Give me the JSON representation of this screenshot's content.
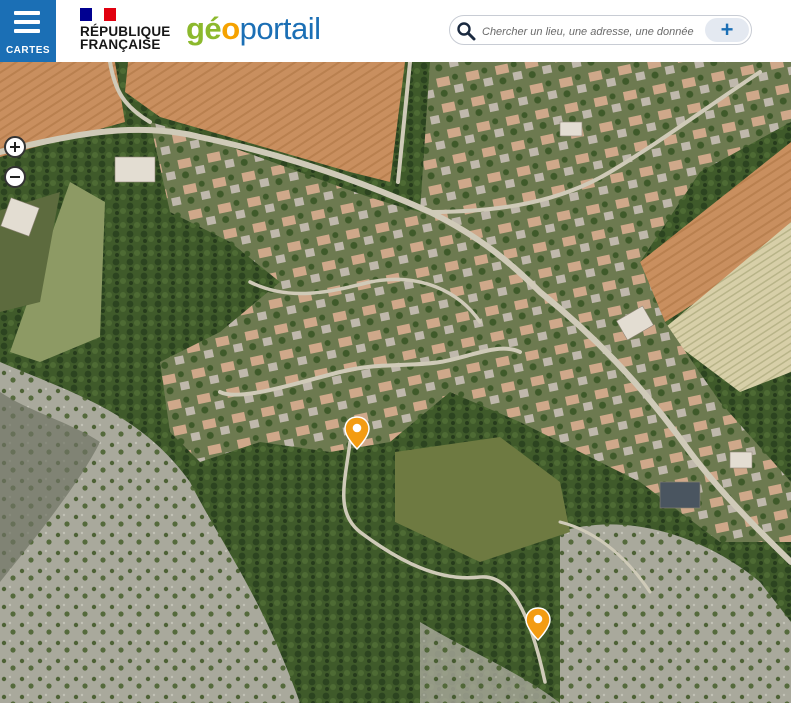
{
  "header": {
    "menu_label": "CARTES",
    "republic_line1": "RÉPUBLIQUE",
    "republic_line2": "FRANÇAISE",
    "logo_part1": "gé",
    "logo_part2": "o",
    "logo_part3": "portail"
  },
  "search": {
    "placeholder": "Chercher un lieu, une adresse, une donnée"
  },
  "map": {
    "layer": "aerial-photography",
    "markers": [
      {
        "name": "marker-1",
        "color": "#f39c12"
      },
      {
        "name": "marker-2",
        "color": "#f39c12"
      }
    ]
  },
  "colors": {
    "brand_blue": "#1b6fb5",
    "logo_green": "#8cb92d",
    "logo_orange": "#f5a200",
    "flag_blue": "#000091",
    "flag_red": "#e1000f"
  }
}
